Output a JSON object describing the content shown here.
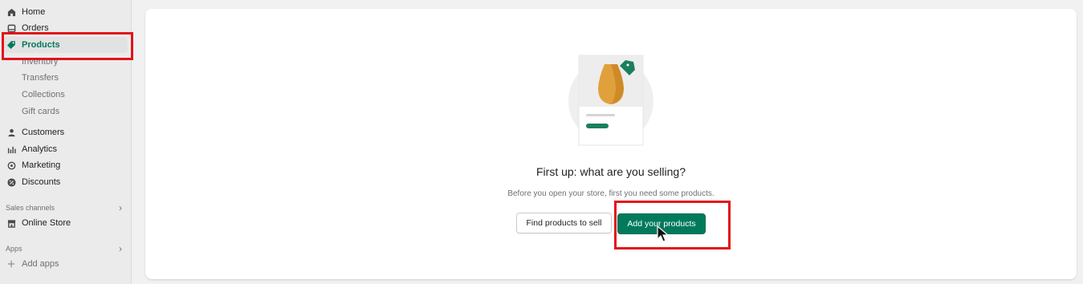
{
  "sidebar": {
    "items": [
      {
        "label": "Home",
        "icon": "home-icon"
      },
      {
        "label": "Orders",
        "icon": "orders-icon"
      },
      {
        "label": "Products",
        "icon": "tag-icon",
        "active": true
      },
      {
        "label": "Inventory"
      },
      {
        "label": "Transfers"
      },
      {
        "label": "Collections"
      },
      {
        "label": "Gift cards"
      },
      {
        "label": "Customers",
        "icon": "person-icon"
      },
      {
        "label": "Analytics",
        "icon": "bar-chart-icon"
      },
      {
        "label": "Marketing",
        "icon": "target-icon"
      },
      {
        "label": "Discounts",
        "icon": "discount-icon"
      },
      {
        "label": "Online Store",
        "icon": "store-icon"
      },
      {
        "label": "Add apps",
        "icon": "plus-icon"
      }
    ],
    "sales_channels_label": "Sales channels",
    "apps_label": "Apps"
  },
  "main": {
    "headline": "First up: what are you selling?",
    "subtext": "Before you open your store, first you need some products.",
    "find_products_label": "Find products to sell",
    "add_products_label": "Add your products"
  },
  "colors": {
    "accent": "#007a5c",
    "highlight": "#e2141b",
    "vase": "#e0a13c"
  }
}
